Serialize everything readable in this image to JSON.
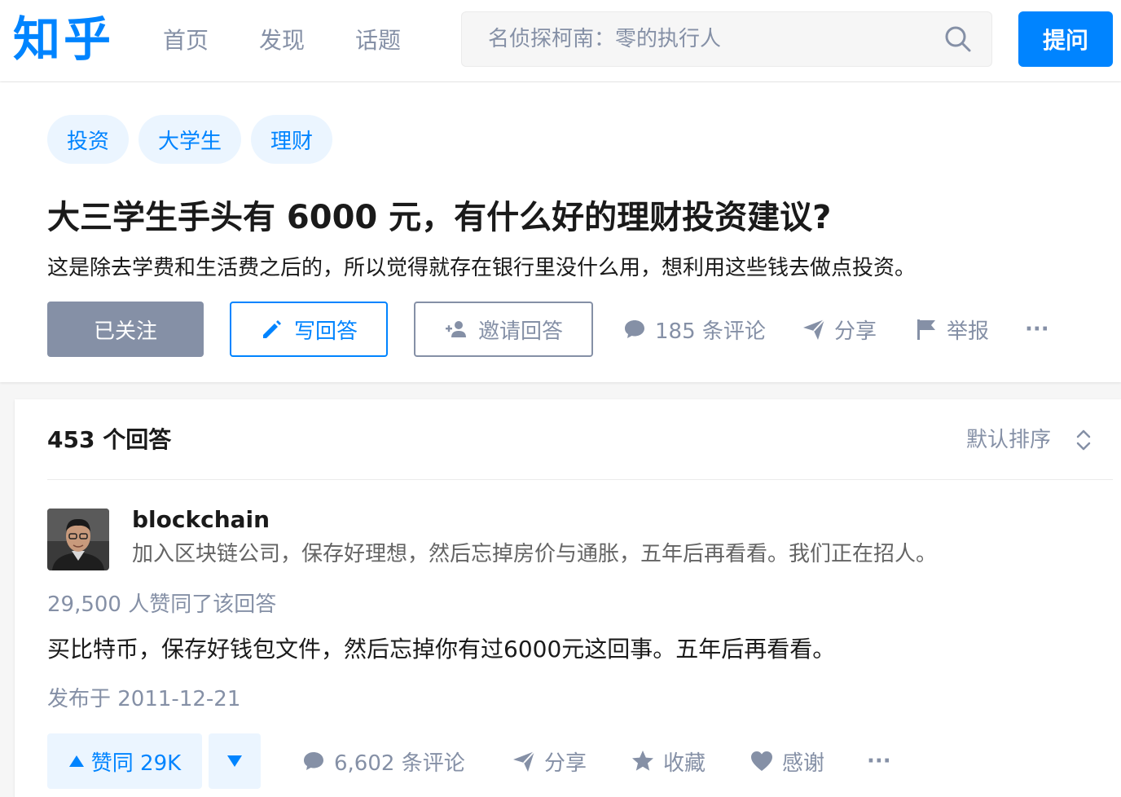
{
  "header": {
    "logo": "知乎",
    "nav": [
      "首页",
      "发现",
      "话题"
    ],
    "search_placeholder": "名侦探柯南：零的执行人",
    "ask_label": "提问"
  },
  "question": {
    "tags": [
      "投资",
      "大学生",
      "理财"
    ],
    "title": "大三学生手头有 6000 元，有什么好的理财投资建议?",
    "detail": "这是除去学费和生活费之后的，所以觉得就存在银行里没什么用，想利用这些钱去做点投资。",
    "follow_label": "已关注",
    "write_label": "写回答",
    "invite_label": "邀请回答",
    "comments_label": "185 条评论",
    "share_label": "分享",
    "report_label": "举报",
    "more_label": "···"
  },
  "answers": {
    "count_label": "453 个回答",
    "sort_label": "默认排序",
    "item": {
      "author_name": "blockchain",
      "author_bio": "加入区块链公司，保存好理想，然后忘掉房价与通胀，五年后再看看。我们正在招人。",
      "vote_summary": "29,500 人赞同了该回答",
      "content": "买比特币，保存好钱包文件，然后忘掉你有过6000元这回事。五年后再看看。",
      "published": "发布于 2011-12-21",
      "upvote_label": "赞同 29K",
      "comments_label": "6,602 条评论",
      "share_label": "分享",
      "collect_label": "收藏",
      "thanks_label": "感谢",
      "more_label": "···"
    }
  },
  "colors": {
    "brand": "#0084ff",
    "muted": "#8590a6",
    "tag_bg": "#ebf5ff"
  }
}
